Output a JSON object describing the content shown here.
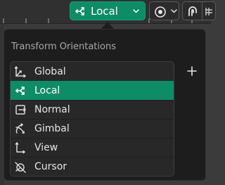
{
  "header": {
    "orientation_value": "Local"
  },
  "popup": {
    "title": "Transform Orientations",
    "items": [
      {
        "label": "Global",
        "icon": "orientation-global-icon",
        "active": false
      },
      {
        "label": "Local",
        "icon": "orientation-local-icon",
        "active": true
      },
      {
        "label": "Normal",
        "icon": "orientation-normal-icon",
        "active": false
      },
      {
        "label": "Gimbal",
        "icon": "orientation-gimbal-icon",
        "active": false
      },
      {
        "label": "View",
        "icon": "orientation-view-icon",
        "active": false
      },
      {
        "label": "Cursor",
        "icon": "orientation-cursor-icon",
        "active": false
      }
    ],
    "add_icon": "plus-icon"
  },
  "colors": {
    "accent": "#0e8c66",
    "panel": "#1d1d1d",
    "item": "#282828",
    "header": "#303030"
  }
}
